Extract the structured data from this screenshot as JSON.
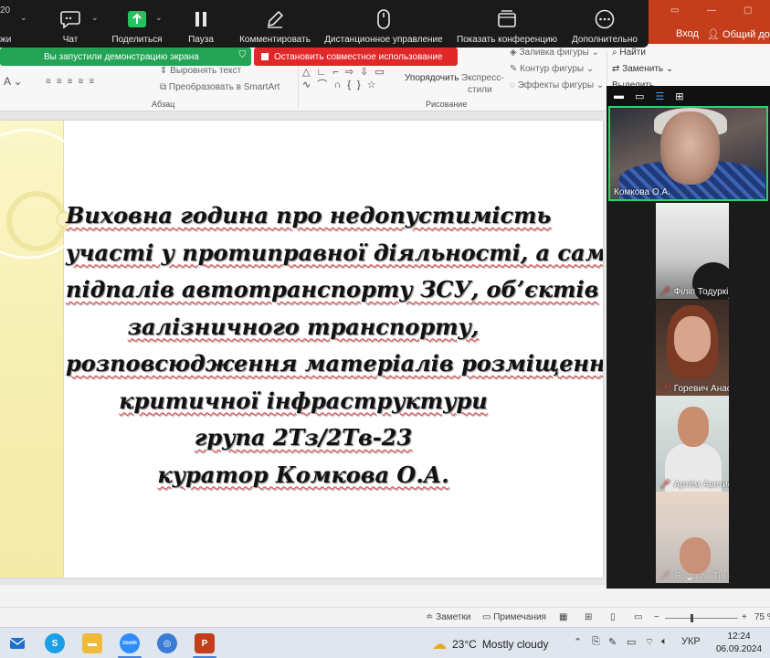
{
  "zoom_toolbar": {
    "edge_text": "20",
    "edge_label": "жи",
    "items": [
      {
        "key": "chat",
        "label": "Чат"
      },
      {
        "key": "share",
        "label": "Поделиться"
      },
      {
        "key": "pause",
        "label": "Пауза"
      },
      {
        "key": "annotate",
        "label": "Комментировать"
      },
      {
        "key": "remote",
        "label": "Дистанционное управление"
      },
      {
        "key": "conference",
        "label": "Показать конференцию"
      },
      {
        "key": "more",
        "label": "Дополнительно"
      }
    ]
  },
  "ppt_title": {
    "login": "Вход",
    "share": "Общий дос"
  },
  "share_banners": {
    "started": "Вы запустили демонстрацию экрана",
    "stop": "Остановить совместное использование"
  },
  "ribbon": {
    "align_text": "Выровнять текст",
    "smartart": "Преобразовать в SmartArt",
    "paragraph_group": "Абзац",
    "arrange": "Упорядочить",
    "quick_styles_1": "Экспресс-",
    "quick_styles_2": "стили",
    "shape_fill": "Заливка фигуры",
    "shape_outline": "Контур фигуры",
    "shape_effects": "Эффекты фигуры",
    "drawing_group": "Рисование",
    "find": "Найти",
    "replace": "Заменить",
    "select": "Выделить"
  },
  "slide": {
    "lines": [
      "Виховна година про недопустимість",
      "участі у протиправної діяльності, а саме",
      "підпалів автотранспорту ЗСУ, об’єктів",
      "залізничного транспорту,",
      "розповсюдження матеріалів розміщення",
      "критичної інфраструктури",
      "група 2Тз/2Тв-23",
      "куратор Комкова О.А."
    ]
  },
  "participants": [
    {
      "name": "Комкова О.А.",
      "muted": false
    },
    {
      "name": "Філіп Тодуркін",
      "muted": true
    },
    {
      "name": "Горевич Анастасия",
      "muted": true
    },
    {
      "name": "Артём Аветисян",
      "muted": true
    },
    {
      "name": "Ярослав Тимо",
      "muted": true
    }
  ],
  "statusbar": {
    "notes": "Заметки",
    "comments": "Примечания",
    "zoom": "75 %"
  },
  "taskbar": {
    "temperature": "23°C",
    "weather": "Mostly cloudy",
    "language": "УКР",
    "time": "12:24",
    "date": "06.09.2024",
    "apps": [
      {
        "icon": "mail-icon",
        "color": "#1f6fcf"
      },
      {
        "icon": "skype-icon",
        "color": "#1aa0e8"
      },
      {
        "icon": "folder-icon",
        "color": "#f0b93a"
      },
      {
        "icon": "zoom-icon",
        "color": "#2d8cff"
      },
      {
        "icon": "browser-icon",
        "color": "#3a7bd5"
      },
      {
        "icon": "powerpoint-icon",
        "color": "#c43e1c"
      }
    ]
  }
}
